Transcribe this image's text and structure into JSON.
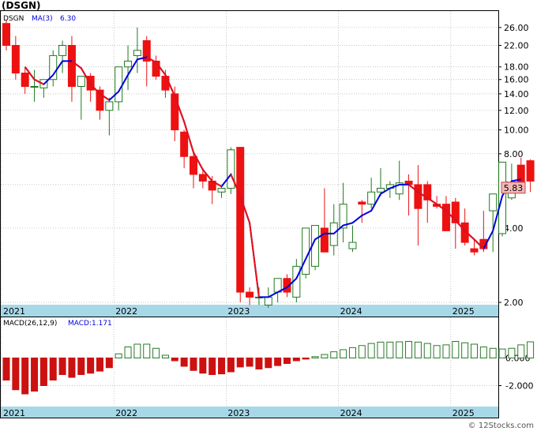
{
  "ticker_title": "(DSGN)",
  "watermark": "© 12Stocks.com",
  "colors": {
    "up": "#1f7a1f",
    "down": "#ee1111",
    "ma": "#0000dd",
    "ma_down": "#ee1111",
    "axis_band": "#a7d8e8",
    "grid": "#b0b0b0",
    "macd_up": "#2a7a2a",
    "macd_down": "#cc1111",
    "last_price_fill": "#f2b8b8"
  },
  "price_panel": {
    "legend_symbol": "DSGN",
    "legend_ma": "MA(3)",
    "legend_ma_value": "6.30",
    "last_price": "5.83",
    "y_tick_labels": [
      "26.00",
      "22.00",
      "18.00",
      "16.00",
      "14.00",
      "12.00",
      "10.00",
      "8.00",
      "6.00",
      "4.00",
      "2.00"
    ],
    "year_labels": [
      "2021",
      "2022",
      "2023",
      "2024",
      "2025"
    ]
  },
  "macd_panel": {
    "legend_params": "MACD(26,12,9)",
    "legend_value": "MACD:1.171",
    "y_tick_labels": [
      "0.000",
      "-2.000"
    ],
    "year_labels": [
      "2021",
      "2022",
      "2023",
      "2024",
      "2025"
    ]
  },
  "chart_data": {
    "type": "candlestick",
    "title": "(DSGN)",
    "period": "monthly",
    "y_scale": "log",
    "ylim": [
      1.9,
      29
    ],
    "x": [
      "2021-01",
      "2021-02",
      "2021-03",
      "2021-04",
      "2021-05",
      "2021-06",
      "2021-07",
      "2021-08",
      "2021-09",
      "2021-10",
      "2021-11",
      "2021-12",
      "2022-01",
      "2022-02",
      "2022-03",
      "2022-04",
      "2022-05",
      "2022-06",
      "2022-07",
      "2022-08",
      "2022-09",
      "2022-10",
      "2022-11",
      "2022-12",
      "2023-01",
      "2023-02",
      "2023-03",
      "2023-04",
      "2023-05",
      "2023-06",
      "2023-07",
      "2023-08",
      "2023-09",
      "2023-10",
      "2023-11",
      "2023-12",
      "2024-01",
      "2024-02",
      "2024-03",
      "2024-04",
      "2024-05",
      "2024-06",
      "2024-07",
      "2024-08",
      "2024-09",
      "2024-10",
      "2024-11",
      "2024-12",
      "2025-01",
      "2025-02",
      "2025-03",
      "2025-04",
      "2025-05",
      "2025-06",
      "2025-07",
      "2025-08",
      "2025-09",
      "2025-10",
      "2025-11",
      "2025-12"
    ],
    "open": [
      27.0,
      22.0,
      17.0,
      15.0,
      14.8,
      16.0,
      20.0,
      22.0,
      15.0,
      16.5,
      14.5,
      12.0,
      13.0,
      18.0,
      20.0,
      23.0,
      19.0,
      16.5,
      14.0,
      9.8,
      7.8,
      6.6,
      6.2,
      5.6,
      5.8,
      8.5,
      2.2,
      2.1,
      1.95,
      2.2,
      2.5,
      2.1,
      2.6,
      2.8,
      4.0,
      3.4,
      4.0,
      3.3,
      5.1,
      5.0,
      5.6,
      5.8,
      5.5,
      6.2,
      6.0,
      6.0,
      5.0,
      5.0,
      5.1,
      4.2,
      3.3,
      3.6,
      4.7,
      3.8,
      5.3,
      7.2,
      7.5,
      null,
      null,
      null
    ],
    "high": [
      28.0,
      24.0,
      18.0,
      17.5,
      16.0,
      21.0,
      23.0,
      24.0,
      16.0,
      17.0,
      15.0,
      13.5,
      16.0,
      22.0,
      26.0,
      24.0,
      20.0,
      17.5,
      15.0,
      10.0,
      8.0,
      7.0,
      6.5,
      5.9,
      8.5,
      8.5,
      2.3,
      2.3,
      2.3,
      2.5,
      2.6,
      3.0,
      4.0,
      4.1,
      5.8,
      5.0,
      6.1,
      4.1,
      5.2,
      6.4,
      7.0,
      6.2,
      7.5,
      6.6,
      7.2,
      6.2,
      5.4,
      5.4,
      5.3,
      4.8,
      3.6,
      4.7,
      4.9,
      5.6,
      7.3,
      7.7,
      7.6,
      null,
      null,
      null
    ],
    "low": [
      21.0,
      16.0,
      14.0,
      13.0,
      13.5,
      15.0,
      17.0,
      13.0,
      11.0,
      13.0,
      11.0,
      9.5,
      12.0,
      14.5,
      17.0,
      15.0,
      16.0,
      13.5,
      9.0,
      7.0,
      5.8,
      5.8,
      5.0,
      5.3,
      5.5,
      2.0,
      1.95,
      1.95,
      1.9,
      2.0,
      2.1,
      2.0,
      2.5,
      2.7,
      3.3,
      3.1,
      3.5,
      3.2,
      4.2,
      4.8,
      5.4,
      5.3,
      5.2,
      4.5,
      3.4,
      4.2,
      4.8,
      4.0,
      3.3,
      3.4,
      3.1,
      3.2,
      3.2,
      3.7,
      5.2,
      6.1,
      5.6,
      null,
      null,
      null
    ],
    "close": [
      22.0,
      17.0,
      15.0,
      15.0,
      16.0,
      20.0,
      22.0,
      15.0,
      16.5,
      14.5,
      12.0,
      13.0,
      18.0,
      19.0,
      21.0,
      19.0,
      16.5,
      14.5,
      10.0,
      7.8,
      6.6,
      6.2,
      5.7,
      5.8,
      8.3,
      2.2,
      2.1,
      2.1,
      2.1,
      2.5,
      2.2,
      2.8,
      4.0,
      4.1,
      3.2,
      4.2,
      5.0,
      3.5,
      5.0,
      5.6,
      5.8,
      6.0,
      6.1,
      6.0,
      4.8,
      5.2,
      4.9,
      3.9,
      4.2,
      3.5,
      3.2,
      3.3,
      5.5,
      7.4,
      5.8,
      5.83,
      6.2,
      null,
      null,
      null
    ],
    "ma3": [
      null,
      null,
      18.0,
      16.0,
      15.3,
      16.7,
      19.0,
      19.0,
      17.8,
      15.3,
      14.0,
      13.2,
      14.3,
      16.7,
      19.3,
      19.7,
      18.8,
      16.7,
      13.7,
      10.8,
      8.1,
      6.9,
      6.2,
      5.9,
      6.6,
      5.4,
      4.2,
      2.1,
      2.1,
      2.2,
      2.3,
      2.5,
      3.0,
      3.6,
      3.8,
      3.8,
      4.1,
      4.2,
      4.5,
      4.7,
      5.5,
      5.8,
      6.0,
      6.0,
      5.6,
      5.3,
      5.0,
      4.7,
      4.3,
      3.9,
      3.6,
      3.3,
      3.9,
      5.4,
      6.2,
      6.3,
      null,
      null,
      null,
      null
    ],
    "macd_histogram": [
      -1.6,
      -2.3,
      -2.6,
      -2.4,
      -2.0,
      -1.6,
      -1.2,
      -1.4,
      -1.2,
      -1.1,
      -0.95,
      -0.7,
      0.3,
      0.8,
      1.0,
      1.0,
      0.7,
      0.2,
      -0.2,
      -0.6,
      -0.9,
      -1.1,
      -1.2,
      -1.15,
      -1.0,
      -0.65,
      -0.6,
      -0.8,
      -0.7,
      -0.55,
      -0.4,
      -0.2,
      -0.08,
      0.1,
      0.25,
      0.45,
      0.6,
      0.75,
      0.9,
      1.05,
      1.15,
      1.15,
      1.17,
      1.2,
      1.15,
      1.05,
      0.9,
      0.95,
      1.2,
      1.1,
      1.0,
      0.8,
      0.7,
      0.65,
      0.7,
      0.95,
      1.171,
      null,
      null,
      null
    ],
    "macd_ylim": [
      -3.4,
      2.6
    ],
    "x_tick_labels": [
      "2021",
      "2022",
      "2023",
      "2024",
      "2025"
    ],
    "y_tick_labels": [
      26,
      22,
      18,
      16,
      14,
      12,
      10,
      8,
      6,
      4,
      2
    ],
    "legend": [
      "DSGN",
      "MA(3) 6.30",
      "MACD(26,12,9)",
      "MACD:1.171"
    ]
  }
}
